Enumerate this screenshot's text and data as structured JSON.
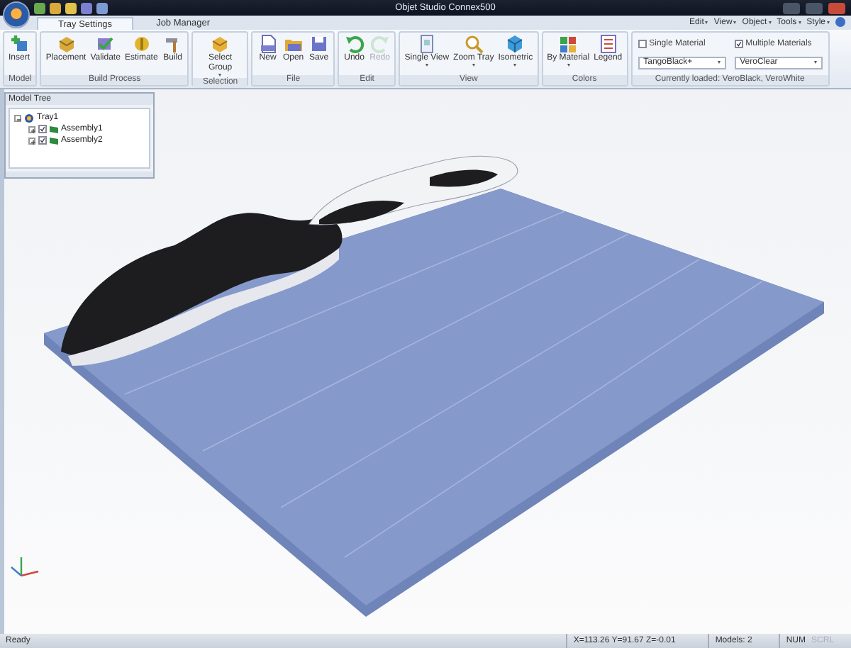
{
  "window": {
    "title": "Objet Studio Connex500"
  },
  "ribbon_tabs": [
    {
      "label": "Tray Settings",
      "selected": true
    },
    {
      "label": "Job Manager",
      "selected": false
    }
  ],
  "menu": [
    "Edit",
    "View",
    "Object",
    "Tools",
    "Style"
  ],
  "ribbon_groups": [
    {
      "caption": "Model",
      "buttons": [
        {
          "label": "Insert",
          "dropdown": false,
          "disabled": false
        }
      ]
    },
    {
      "caption": "Build Process",
      "buttons": [
        {
          "label": "Placement",
          "dropdown": false,
          "disabled": false
        },
        {
          "label": "Validate",
          "dropdown": false,
          "disabled": false
        },
        {
          "label": "Estimate",
          "dropdown": false,
          "disabled": false
        },
        {
          "label": "Build",
          "dropdown": false,
          "disabled": false
        }
      ]
    },
    {
      "caption": "Selection",
      "buttons": [
        {
          "label": "Select Group",
          "dropdown": true,
          "disabled": false
        }
      ]
    },
    {
      "caption": "File",
      "buttons": [
        {
          "label": "New",
          "dropdown": false,
          "disabled": false
        },
        {
          "label": "Open",
          "dropdown": false,
          "disabled": false
        },
        {
          "label": "Save",
          "dropdown": false,
          "disabled": false
        }
      ]
    },
    {
      "caption": "Edit",
      "buttons": [
        {
          "label": "Undo",
          "dropdown": false,
          "disabled": false
        },
        {
          "label": "Redo",
          "dropdown": false,
          "disabled": true
        }
      ]
    },
    {
      "caption": "View",
      "buttons": [
        {
          "label": "Single View",
          "dropdown": true,
          "disabled": false
        },
        {
          "label": "Zoom Tray",
          "dropdown": true,
          "disabled": false
        },
        {
          "label": "Isometric",
          "dropdown": true,
          "disabled": false
        }
      ]
    },
    {
      "caption": "Colors",
      "buttons": [
        {
          "label": "By Material",
          "dropdown": true,
          "disabled": false
        },
        {
          "label": "Legend",
          "dropdown": false,
          "disabled": false
        }
      ]
    }
  ],
  "materials": {
    "caption": "Currently loaded: VeroBlack, VeroWhite",
    "checkboxes": [
      {
        "label": "Single Material",
        "checked": false
      },
      {
        "label": "Multiple Materials",
        "checked": true
      }
    ],
    "dropdowns": [
      {
        "value": "TangoBlack+"
      },
      {
        "value": "VeroClear"
      }
    ]
  },
  "model_tree": {
    "title": "Model Tree",
    "items": [
      {
        "label": "Tray1",
        "expanded": true,
        "children": [
          {
            "label": "Assembly1",
            "checked": true,
            "expanded": false
          },
          {
            "label": "Assembly2",
            "checked": true,
            "expanded": false
          }
        ]
      }
    ]
  },
  "status_bar": {
    "status": "Ready",
    "coordinates": "X=113.26 Y=91.67 Z=-0.01",
    "models": "Models: 2",
    "indicators": [
      {
        "label": "NUM",
        "active": true
      },
      {
        "label": "SCRL",
        "active": false
      }
    ]
  }
}
